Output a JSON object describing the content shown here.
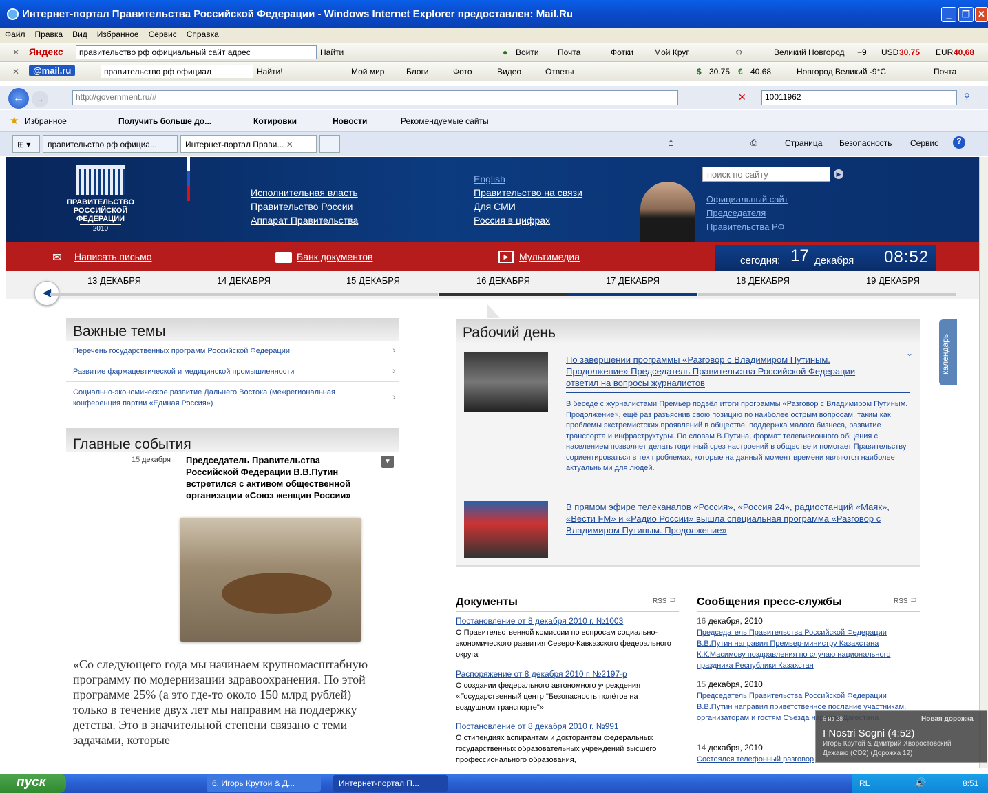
{
  "window": {
    "title": "Интернет-портал Правительства Российской Федерации - Windows Internet Explorer предоставлен: Mail.Ru"
  },
  "menu": [
    "Файл",
    "Правка",
    "Вид",
    "Избранное",
    "Сервис",
    "Справка"
  ],
  "yandex_bar": {
    "logo": "Яндекс",
    "query": "правительство рф официальный сайт адрес",
    "find": "Найти",
    "login": "Войти",
    "mail": "Почта",
    "photos": "Фотки",
    "circle": "Мой Круг",
    "weather": "Великий Новгород",
    "temp": "−9",
    "usd_label": "USD",
    "usd": "30,75",
    "eur_label": "EUR",
    "eur": "40,68"
  },
  "mailru_bar": {
    "logo": "@mail.ru",
    "query": "правительство рф официал",
    "find": "Найти!",
    "myworld": "Мой мир",
    "blogs": "Блоги",
    "photo": "Фото",
    "video": "Видео",
    "answers": "Ответы",
    "usd": "30.75",
    "eur": "40.68",
    "weather": "Новгород Великий -9°C",
    "mail": "Почта"
  },
  "address": {
    "url": "http://government.ru/#",
    "search": "10011962"
  },
  "favorites": {
    "label": "Избранное",
    "items": [
      "Получить больше до...",
      "Котировки",
      "Новости",
      "Рекомендуемые сайты"
    ]
  },
  "tabs": [
    {
      "label": "правительство рф официа..."
    },
    {
      "label": "Интернет-портал Прави..."
    }
  ],
  "cmdbar": {
    "page": "Страница",
    "security": "Безопасность",
    "service": "Сервис"
  },
  "site": {
    "logo_lines": [
      "ПРАВИТЕЛЬСТВО",
      "РОССИЙСКОЙ",
      "ФЕДЕРАЦИИ"
    ],
    "logo_year": "2010",
    "nav_left": [
      "Исполнительная власть",
      "Правительство России",
      "Аппарат Правительства"
    ],
    "nav_right": [
      "English",
      "Правительство на связи",
      "Для СМИ",
      "Россия в цифрах"
    ],
    "search_placeholder": "поиск по сайту",
    "official": [
      "Официальный сайт",
      "Председателя",
      "Правительства РФ"
    ],
    "write": "Написать письмо",
    "docs_bank": "Банк документов",
    "multimedia": "Мультимедиа",
    "today": "сегодня:",
    "day": "17",
    "month": "декабря",
    "time": "08:52",
    "days": [
      "13 ДЕКАБРЯ",
      "14 ДЕКАБРЯ",
      "15 ДЕКАБРЯ",
      "16 ДЕКАБРЯ",
      "17 ДЕКАБРЯ",
      "18 ДЕКАБРЯ",
      "19 ДЕКАБРЯ"
    ],
    "important_title": "Важные темы",
    "important": [
      "Перечень государственных программ Российской Федерации",
      "Развитие фармацевтической и медицинской промышленности",
      "Социально-экономическое развитие Дальнего Востока (межрегиональная конференция партии «Единая Россия»)"
    ],
    "events_title": "Главные события",
    "event_date_num": "15",
    "event_date_month": "декабря",
    "event_title": "Председатель Правительства Российской Федерации В.В.Путин встретился с активом общественной организации «Союз женщин России»",
    "quote": "«Со следующего года мы начинаем крупномасштабную программу по модернизации здравоохранения. По этой программе 25% (а это где-то около 150 млрд рублей) только в течение двух лет мы направим на поддержку детства. Это в значительной степени связано с теми задачами, которые",
    "workday_title": "Рабочий день",
    "news1_title": "По завершении программы «Разговор с Владимиром Путиным. Продолжение» Председатель Правительства Российской Федерации ответил на вопросы журналистов",
    "news1_text": "В беседе с журналистами Премьер подвёл итоги программы «Разговор с Владимиром Путиным. Продолжение», ещё раз разъяснив свою позицию по наиболее острым вопросам, таким как проблемы экстремистских проявлений в обществе, поддержка малого бизнеса, развитие транспорта и инфраструктуры. По словам В.Путина, формат телевизионного общения с населением позволяет делать годичный срез настроений в обществе и помогает Правительству сориентироваться в тех проблемах, которые на данный момент времени являются наиболее актуальными для людей.",
    "news2_title": "В прямом эфире телеканалов «Россия», «Россия 24», радиостанций «Маяк», «Вести FM» и «Радио России» вышла специальная программа «Разговор с Владимиром Путиным. Продолжение»",
    "calendar": "календарь",
    "docs_title": "Документы",
    "rss": "RSS",
    "docs": [
      {
        "link": "Постановление от 8 декабря 2010 г. №1003",
        "text": "О Правительственной комиссии по вопросам социально-экономического развития Северо-Кавказского федерального округа"
      },
      {
        "link": "Распоряжение от 8 декабря 2010 г. №2197-р",
        "text": "О создании федерального автономного учреждения «Государственный центр \"Безопасность полётов на воздушном транспорте\"»"
      },
      {
        "link": "Постановление от 8 декабря 2010 г. №991",
        "text": "О стипендиях аспирантам и докторантам федеральных государственных образовательных учреждений высшего профессионального образования,"
      }
    ],
    "press_title": "Сообщения пресс-службы",
    "press": [
      {
        "date_num": "16",
        "date_rest": "декабря, 2010",
        "text": "Председатель Правительства Российской Федерации В.В.Путин направил Премьер-министру Казахстана К.К.Масимову поздравления по случаю национального праздника Республики Казахстан"
      },
      {
        "date_num": "15",
        "date_rest": "декабря, 2010",
        "text": "Председатель Правительства Российской Федерации В.В.Путин направил приветственное послание участникам, организаторам и гостям Съезда народов Дагестана"
      },
      {
        "date_num": "14",
        "date_rest": "декабря, 2010",
        "text": "Состоялся телефонный разговор"
      }
    ]
  },
  "player": {
    "counter": "6 из 28",
    "label": "Новая дорожка",
    "song": "I Nostri Sogni (4:52)",
    "artist": "Игорь Крутой & Дмитрий Хворостовский",
    "album": "Дежавю (CD2) (Дорожка 12)"
  },
  "taskbar": {
    "start": "пуск",
    "task1": "6. Игорь Крутой & Д...",
    "task2": "Интернет-портал П...",
    "lang": "RL",
    "clock": "8:51"
  }
}
